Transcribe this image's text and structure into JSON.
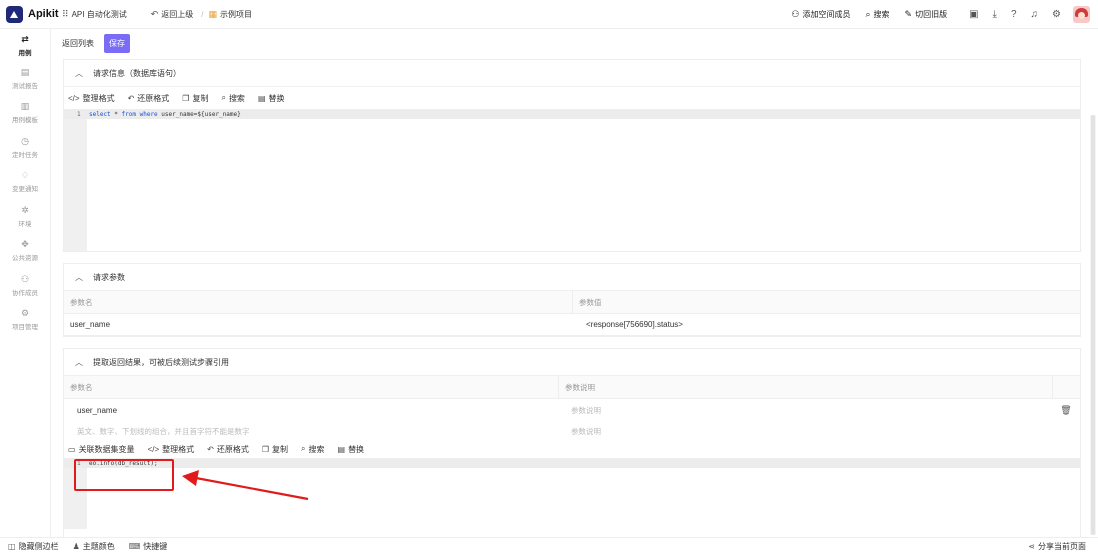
{
  "app": {
    "name": "Apikit"
  },
  "topbar": {
    "module": "API 自动化测试",
    "back": "返回上级",
    "separator": "/",
    "project": "示例项目",
    "add_member": "添加空间成员",
    "search": "搜索",
    "switch_old": "切回旧版"
  },
  "sidebar": {
    "items": [
      {
        "label": "用例",
        "icon": "swap-icon"
      },
      {
        "label": "测试报告",
        "icon": "report-icon"
      },
      {
        "label": "用例模板",
        "icon": "template-icon"
      },
      {
        "label": "定时任务",
        "icon": "timer-icon"
      },
      {
        "label": "变更通知",
        "icon": "bell-icon"
      },
      {
        "label": "环境",
        "icon": "gear-icon"
      },
      {
        "label": "公共资源",
        "icon": "puzzle-icon"
      },
      {
        "label": "协作成员",
        "icon": "users-icon"
      },
      {
        "label": "项目管理",
        "icon": "settings-icon"
      }
    ]
  },
  "toolbar": {
    "back_list": "返回列表",
    "save": "保存"
  },
  "request_info": {
    "title": "请求信息（数据库语句）",
    "tools": [
      "整理格式",
      "还原格式",
      "复制",
      "搜索",
      "替换"
    ],
    "line_number": "1",
    "code_prefix": "select ",
    "code_star": "*",
    "code_from": " from ",
    "code_where": "where",
    "code_rest": " user_name=${user_name}"
  },
  "request_params": {
    "title": "请求参数",
    "col_name": "参数名",
    "col_value": "参数值",
    "rows": [
      {
        "name": "user_name",
        "value": "<response[756690].status>"
      }
    ]
  },
  "extract": {
    "title": "提取返回结果，可被后续测试步骤引用",
    "col_name": "参数名",
    "col_desc": "参数说明",
    "rows": [
      {
        "name": "user_name",
        "desc": "参数说明"
      }
    ],
    "new_name_placeholder": "英文、数字、下划线的组合，并且首字符不能是数字",
    "new_desc_placeholder": "参数说明",
    "tools": [
      "关联数据集变量",
      "整理格式",
      "还原格式",
      "复制",
      "搜索",
      "替换"
    ],
    "line_number": "1",
    "code": "eo.info(db_result);"
  },
  "bottombar": {
    "hide_sidebar": "隐藏侧边栏",
    "theme": "主题颜色",
    "shortcuts": "快捷键",
    "share": "分享当前页面"
  },
  "colors": {
    "accent": "#7b6cf6",
    "brand": "#1e2a78",
    "highlight": "#e11b1b"
  }
}
